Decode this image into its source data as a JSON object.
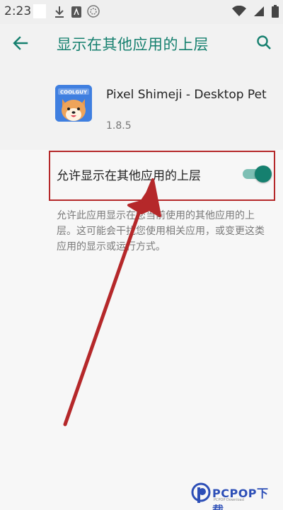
{
  "status_bar": {
    "time": "2:23"
  },
  "app_bar": {
    "title": "显示在其他应用的上层",
    "back_icon": "arrow-back-icon",
    "search_icon": "search-icon"
  },
  "app_info": {
    "name": "Pixel Shimeji - Desktop Pet",
    "version": "1.8.5",
    "icon_text": "COOLGUY"
  },
  "permission": {
    "label": "允许显示在其他应用的上层",
    "enabled": true,
    "description": "允许此应用显示在您当前使用的其他应用的上层。这可能会干扰您使用相关应用，或变更这类应用的显示或运行方式。"
  },
  "watermark": {
    "text": "PCPOP下载",
    "subtext": "PCPOP Download"
  },
  "colors": {
    "accent": "#16806f",
    "annotation": "#b5282a",
    "watermark": "#2d4fb7"
  }
}
